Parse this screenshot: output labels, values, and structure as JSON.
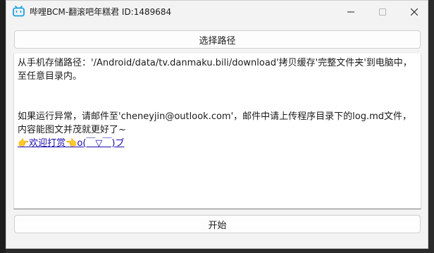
{
  "window": {
    "title": "哔哩BCM-翻滚吧年糕君 ID:1489684",
    "accent_color": "#1ba1e2"
  },
  "buttons": {
    "select_path": "选择路径",
    "start": "开始"
  },
  "content": {
    "instruction": "从手机存储路径：'/Android/data/tv.danmaku.bili/download'拷贝缓存'完整文件夹'到电脑中，至任意目录内。",
    "error_help": "如果运行异常，请邮件至'cheneyjin@outlook.com'，邮件中请上传程序目录下的log.md文件，内容能图文并茂就更好了~",
    "donate_link": "👉欢迎打赏👈o(￣▽￣)ブ"
  },
  "icons": {
    "app": "bilibili-tv-icon",
    "minimize": "minimize-icon",
    "maximize": "maximize-icon",
    "close": "close-icon"
  }
}
